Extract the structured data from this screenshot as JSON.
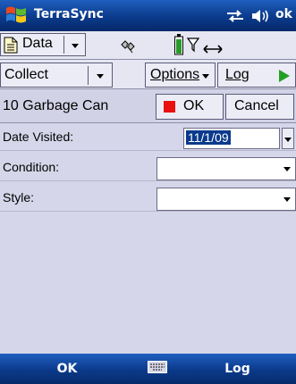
{
  "titlebar": {
    "title": "TerraSync",
    "ok_label": "ok",
    "start_icon": "windows-flag-icon",
    "connection_icon": "connectivity-icon",
    "volume_icon": "speaker-icon"
  },
  "toolbar_top": {
    "data_label": "Data",
    "data_icon": "document-icon",
    "status_icons": [
      "satellite-icon",
      "battery-icon",
      "filter-icon",
      "double-arrow-icon"
    ]
  },
  "toolbar_collect": {
    "collect_label": "Collect",
    "options_label": "Options",
    "log_label": "Log",
    "log_icon": "play-icon"
  },
  "feature": {
    "name": "10 Garbage Can",
    "ok_label": "OK",
    "cancel_label": "Cancel"
  },
  "form": {
    "fields": [
      {
        "label": "Date Visited:",
        "value": "11/1/09"
      },
      {
        "label": "Condition:",
        "value": ""
      },
      {
        "label": "Style:",
        "value": ""
      }
    ]
  },
  "menubar": {
    "left_label": "OK",
    "right_label": "Log",
    "center_icon": "keyboard-icon"
  },
  "colors": {
    "titlebar": "#0b3a8a",
    "background": "#d6d6ea",
    "ok_square": "#e81010",
    "log_play": "#22a022",
    "selection": "#0a3a8c"
  }
}
